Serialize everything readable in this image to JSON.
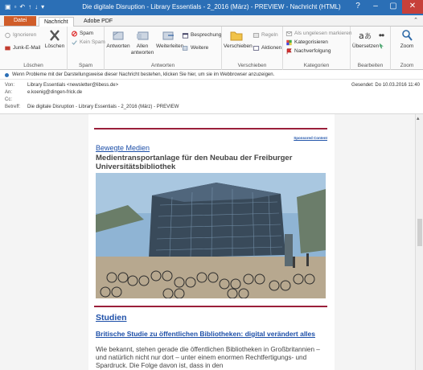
{
  "window": {
    "title": "Die digitale Disruption - Library Essentials - 2_2016 (März) - PREVIEW - Nachricht (HTML)",
    "controls": [
      "?",
      "–",
      "▢",
      "✕"
    ]
  },
  "tabs": {
    "file": "Datei",
    "message": "Nachricht",
    "adobe": "Adobe PDF",
    "help_caret": "⌃"
  },
  "ribbon": {
    "loeschen": {
      "ignore": "Ignorieren",
      "delete": "Löschen",
      "junk": "Junk-E-Mail",
      "label": "Löschen"
    },
    "spam": {
      "spam": "Spam",
      "no_spam": "Kein Spam",
      "label": "Spam"
    },
    "antworten": {
      "reply": "Antworten",
      "reply_all": "Allen antworten",
      "forward": "Weiterleiten",
      "meeting": "Besprechung",
      "more": "Weitere",
      "label": "Antworten"
    },
    "verschieben": {
      "move": "Verschieben",
      "rules": "Regeln",
      "actions": "Aktionen",
      "label": "Verschieben"
    },
    "kategorien": {
      "mark_unread": "Als ungelesen markieren",
      "categorize": "Kategorisieren",
      "followup": "Nachverfolgung",
      "label": "Kategorien"
    },
    "bearbeiten": {
      "translate": "Übersetzen",
      "label": "Bearbeiten"
    },
    "zoom": {
      "zoom": "Zoom",
      "label": "Zoom"
    }
  },
  "infobar": "Wenn Probleme mit der Darstellungsweise dieser Nachricht bestehen, klicken Sie hier, um sie im Webbrowser anzuzeigen.",
  "headers": {
    "from_label": "Von:",
    "from": "Library Essentials <newsletter@libess.de>",
    "to_label": "An:",
    "to": "e.koenig@dingen-frick.de",
    "cc_label": "Cc:",
    "subject_label": "Betreff:",
    "subject": "Die digitale Disruption - Library Essentials - 2_2016 (März) - PREVIEW",
    "sent": "Gesendet:  Do 10.03.2016 11:40"
  },
  "newsletter": {
    "sponsored": "Sponsored Content",
    "kicker": "Bewegte Medien",
    "headline": "Medientransportanlage für den Neubau der Freiburger Universitätsbibliothek",
    "section": "Studien",
    "article_title": "Britische Studie zu öffentlichen Bibliotheken: digital verändert alles",
    "article_body": "Wie bekannt, stehen gerade die öffentlichen Bibliotheken in Großbritannien – und natürlich nicht nur dort – unter einem enormen Rechtfertigungs- und Spardruck. Die Folge davon ist, dass in den"
  },
  "colors": {
    "titlebar": "#2b6fb6",
    "file_tab": "#d05d29",
    "accent_line": "#9a1f3a",
    "link": "#1d4fa8"
  }
}
